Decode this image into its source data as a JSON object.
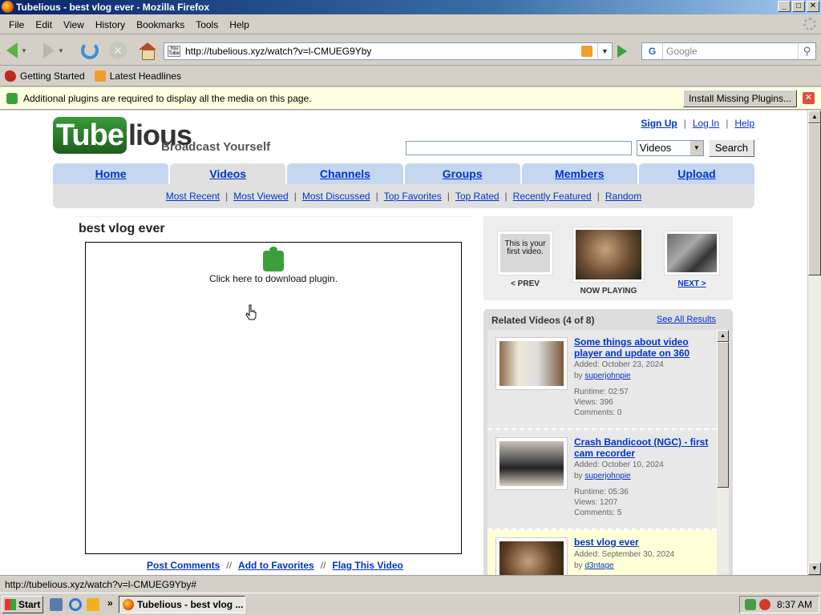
{
  "window": {
    "title": "Tubelious - best vlog ever - Mozilla Firefox",
    "btn_min": "_",
    "btn_max": "□",
    "btn_close": "✕"
  },
  "menu": [
    "File",
    "Edit",
    "View",
    "History",
    "Bookmarks",
    "Tools",
    "Help"
  ],
  "nav": {
    "url": "http://tubelious.xyz/watch?v=l-CMUEG9Yby",
    "search_placeholder": "Google"
  },
  "bookmarks": [
    "Getting Started",
    "Latest Headlines"
  ],
  "notice": {
    "message": "Additional plugins are required to display all the media on this page.",
    "install_label": "Install Missing Plugins..."
  },
  "site": {
    "logo_box": "Tube",
    "logo_rest": "lious",
    "tagline": "Broadcast Yourself",
    "toplinks": {
      "signup": "Sign Up",
      "login": "Log In",
      "help": "Help"
    },
    "search": {
      "category": "Videos",
      "button": "Search"
    },
    "tabs": [
      "Home",
      "Videos",
      "Channels",
      "Groups",
      "Members",
      "Upload"
    ],
    "subnav": [
      "Most Recent",
      "Most Viewed",
      "Most Discussed",
      "Top Favorites",
      "Top Rated",
      "Recently Featured",
      "Random"
    ]
  },
  "video": {
    "title": "best vlog ever",
    "plugin_text": "Click here to download plugin.",
    "actions": [
      "Post Comments",
      "Add to Favorites",
      "Flag This Video"
    ]
  },
  "playnav": {
    "prev_thumb_text": "This is your first video.",
    "prev_label": "< PREV",
    "now_label": "NOW PLAYING",
    "next_label": "NEXT >"
  },
  "related": {
    "header": "Related Videos (4 of 8)",
    "see_all": "See All Results",
    "items": [
      {
        "title": "Some things about video player and update on 360",
        "added": "Added: October 23, 2024",
        "by": "by",
        "user": "superjohnpie",
        "runtime": "Runtime: 02:57",
        "views": "Views: 396",
        "comments": "Comments: 0"
      },
      {
        "title": "Crash Bandicoot (NGC) - first cam recorder",
        "added": "Added: October 10, 2024",
        "by": "by",
        "user": "superjohnpie",
        "runtime": "Runtime: 05:36",
        "views": "Views: 1207",
        "comments": "Comments: 5"
      },
      {
        "title": "best vlog ever",
        "added": "Added: September 30, 2024",
        "by": "by",
        "user": "d3ntage"
      }
    ]
  },
  "statusbar": {
    "text": "http://tubelious.xyz/watch?v=l-CMUEG9Yby#"
  },
  "taskbar": {
    "start": "Start",
    "more": "»",
    "task_label": "Tubelious - best vlog ...",
    "clock": "8:37 AM"
  }
}
